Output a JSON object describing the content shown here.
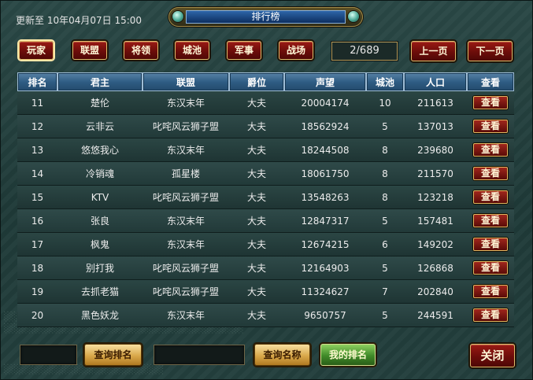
{
  "header": {
    "updated": "更新至 10年04月07日 15:00",
    "title": "排行榜"
  },
  "tabs": [
    {
      "label": "玩家",
      "selected": true
    },
    {
      "label": "联盟",
      "selected": false
    },
    {
      "label": "将领",
      "selected": false
    },
    {
      "label": "城池",
      "selected": false
    },
    {
      "label": "军事",
      "selected": false
    },
    {
      "label": "战场",
      "selected": false
    }
  ],
  "pager": {
    "page": "2/689",
    "prev_label": "上一页",
    "next_label": "下一页"
  },
  "table": {
    "columns": [
      "排名",
      "君主",
      "联盟",
      "爵位",
      "声望",
      "城池",
      "人口",
      "查看"
    ],
    "view_label": "查看",
    "rows": [
      {
        "rank": "11",
        "lord": "楚伦",
        "alliance": "东汉末年",
        "title": "大夫",
        "prestige": "20004174",
        "cities": "10",
        "population": "211613"
      },
      {
        "rank": "12",
        "lord": "云非云",
        "alliance": "叱咤风云狮子盟",
        "title": "大夫",
        "prestige": "18562924",
        "cities": "5",
        "population": "137013"
      },
      {
        "rank": "13",
        "lord": "悠悠我心",
        "alliance": "东汉末年",
        "title": "大夫",
        "prestige": "18244508",
        "cities": "8",
        "population": "239680"
      },
      {
        "rank": "14",
        "lord": "冷销魂",
        "alliance": "孤星楼",
        "title": "大夫",
        "prestige": "18061750",
        "cities": "8",
        "population": "211570"
      },
      {
        "rank": "15",
        "lord": "KTV",
        "alliance": "叱咤风云狮子盟",
        "title": "大夫",
        "prestige": "13548263",
        "cities": "8",
        "population": "123218"
      },
      {
        "rank": "16",
        "lord": "张良",
        "alliance": "东汉末年",
        "title": "大夫",
        "prestige": "12847317",
        "cities": "5",
        "population": "157481"
      },
      {
        "rank": "17",
        "lord": "枫鬼",
        "alliance": "东汉末年",
        "title": "大夫",
        "prestige": "12674215",
        "cities": "6",
        "population": "149202"
      },
      {
        "rank": "18",
        "lord": "别打我",
        "alliance": "叱咤风云狮子盟",
        "title": "大夫",
        "prestige": "12164903",
        "cities": "5",
        "population": "126868"
      },
      {
        "rank": "19",
        "lord": "去抓老猫",
        "alliance": "叱咤风云狮子盟",
        "title": "大夫",
        "prestige": "11324627",
        "cities": "7",
        "population": "202840"
      },
      {
        "rank": "20",
        "lord": "黑色妖龙",
        "alliance": "东汉末年",
        "title": "大夫",
        "prestige": "9650757",
        "cities": "5",
        "population": "244591"
      }
    ]
  },
  "footer": {
    "search_rank_label": "查询排名",
    "search_name_label": "查询名称",
    "my_rank_label": "我的排名",
    "close_label": "关闭"
  },
  "colors": {
    "tab_red": "#8a1410",
    "header_blue": "#2f5d84",
    "gold": "#d9a84a",
    "green": "#3f8a28"
  }
}
